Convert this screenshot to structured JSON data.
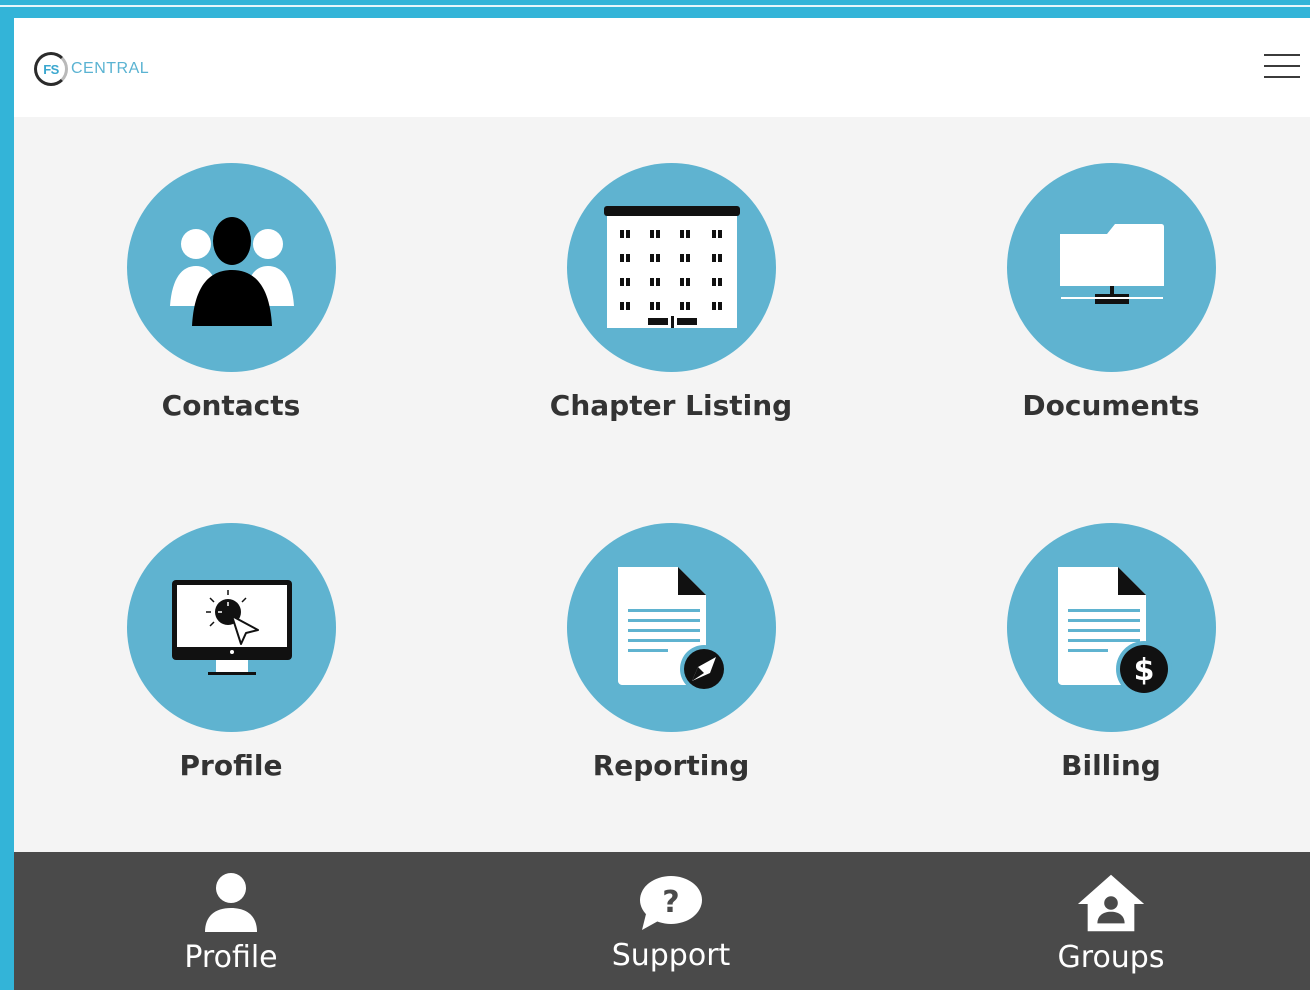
{
  "header": {
    "logo_badge": "FS",
    "logo_text": "CENTRAL",
    "menu_icon": "hamburger-menu-icon"
  },
  "tiles": [
    {
      "label": "Contacts",
      "icon": "contacts-group-icon"
    },
    {
      "label": "Chapter Listing",
      "icon": "building-icon"
    },
    {
      "label": "Documents",
      "icon": "network-folder-icon"
    },
    {
      "label": "Profile",
      "icon": "monitor-cursor-icon"
    },
    {
      "label": "Reporting",
      "icon": "document-pencil-icon"
    },
    {
      "label": "Billing",
      "icon": "document-dollar-icon"
    }
  ],
  "bottom_nav": [
    {
      "label": "Profile",
      "icon": "user-icon"
    },
    {
      "label": "Support",
      "icon": "question-bubble-icon"
    },
    {
      "label": "Groups",
      "icon": "house-user-icon"
    }
  ],
  "colors": {
    "accent": "#5fb3d0",
    "frame": "#33b4d8",
    "nav_bg": "#4a4a4a",
    "page_bg": "#f4f4f4"
  }
}
